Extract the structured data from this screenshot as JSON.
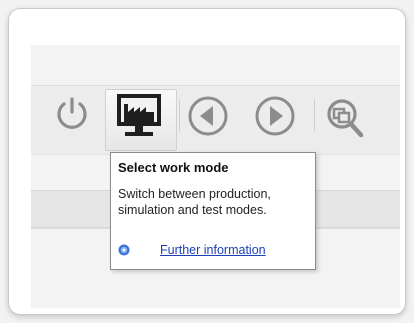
{
  "toolbar": {
    "buttons": [
      {
        "name": "power",
        "icon": "power-icon"
      },
      {
        "name": "work-mode",
        "icon": "monitor-factory-icon",
        "active": true
      },
      {
        "name": "back",
        "icon": "arrow-left-circle-icon"
      },
      {
        "name": "forward",
        "icon": "arrow-right-circle-icon"
      },
      {
        "name": "search",
        "icon": "zoom-search-icon"
      }
    ]
  },
  "tooltip": {
    "title": "Select work mode",
    "description": "Switch between production, simulation and test modes.",
    "link_text": "Further information",
    "help_icon": "help-circle-icon"
  },
  "colors": {
    "icon_gray": "#8c8c8c",
    "icon_dark": "#1f1f1f",
    "link_blue": "#1a3fb8"
  }
}
